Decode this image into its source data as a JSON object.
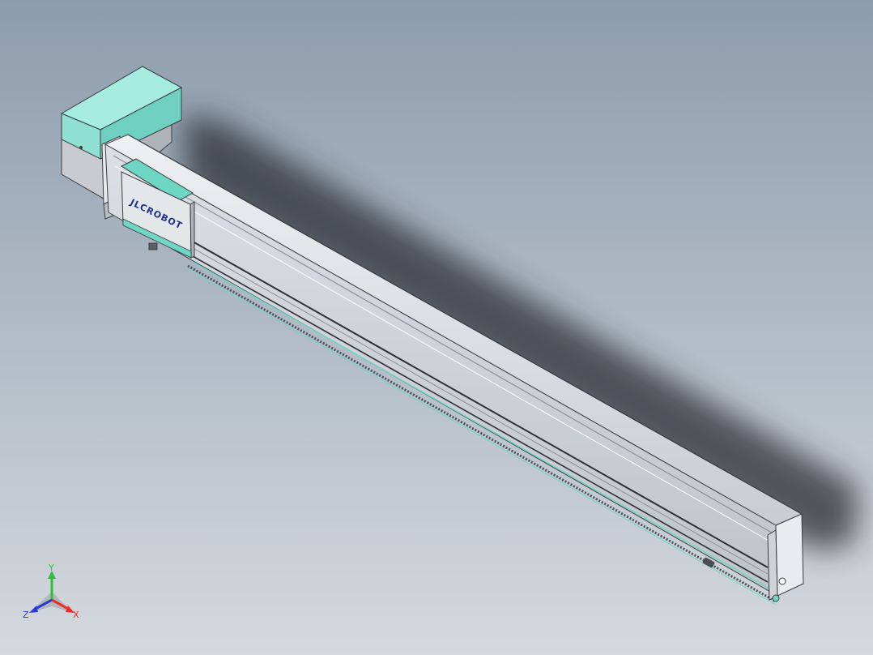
{
  "viewport": {
    "background_top": "#8d9cad",
    "background_bottom": "#d5d9de"
  },
  "model": {
    "carriage_brand": "JLCROBOT",
    "motor_housing_color": "#8fe0d2",
    "rail_body_color": "#d8dbe0",
    "accent_color": "#6fd6c4"
  },
  "triad": {
    "x_label": "X",
    "y_label": "Y",
    "z_label": "Z",
    "x_color": "#e8302a",
    "y_color": "#2fbf3a",
    "z_color": "#2a3ad8"
  }
}
